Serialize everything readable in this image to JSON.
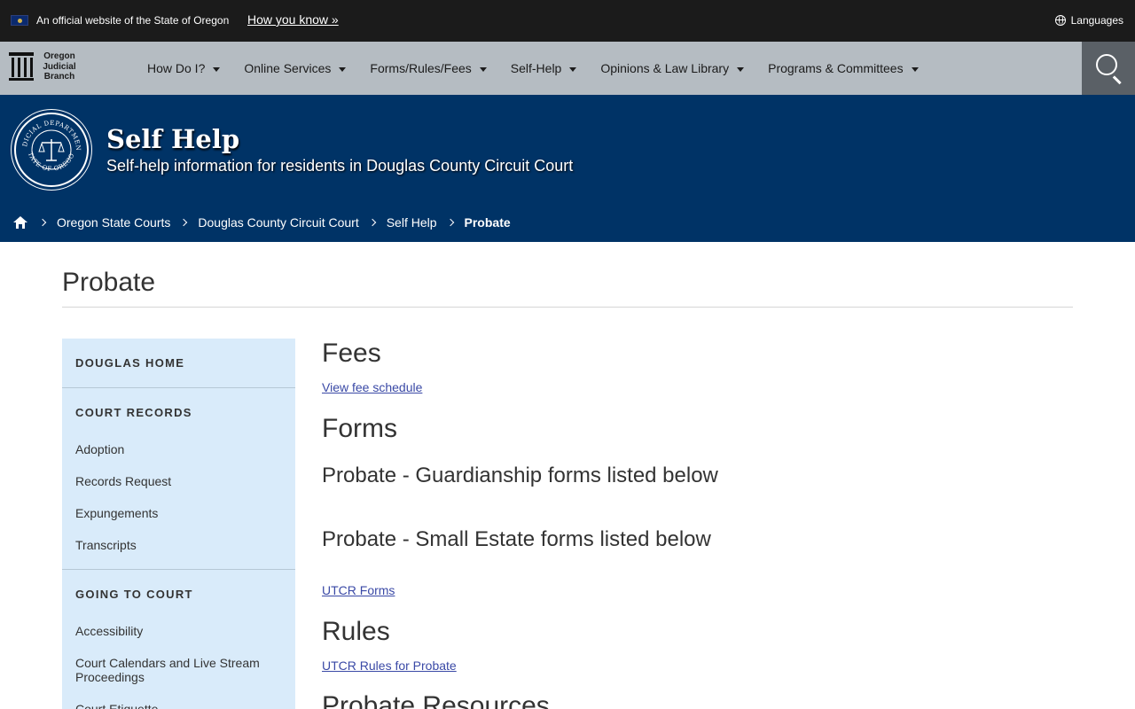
{
  "official_bar": {
    "text": "An official website of the State of Oregon",
    "how_you_know": "How you know »",
    "languages": "Languages"
  },
  "nav": {
    "logo_lines": [
      "Oregon",
      "Judicial",
      "Branch"
    ],
    "items": [
      {
        "label": "How Do I?"
      },
      {
        "label": "Online Services"
      },
      {
        "label": "Forms/Rules/Fees"
      },
      {
        "label": "Self-Help"
      },
      {
        "label": "Opinions & Law Library"
      },
      {
        "label": "Programs & Committees"
      }
    ],
    "search_icon": "search-icon"
  },
  "hero": {
    "title": "Self Help",
    "subtitle": "Self-help information for residents in Douglas County Circuit Court",
    "seal_text_top": "JUDICIAL DEPARTMENT",
    "seal_text_bottom": "STATE OF OREGON"
  },
  "breadcrumb": {
    "items": [
      "Oregon State Courts",
      "Douglas County Circuit Court",
      "Self Help"
    ],
    "current": "Probate"
  },
  "page": {
    "title": "Probate"
  },
  "sidebar": {
    "sections": [
      {
        "heading": "DOUGLAS HOME",
        "items": []
      },
      {
        "heading": "COURT RECORDS",
        "items": [
          "Adoption",
          "Records Request",
          "Expungements",
          "Transcripts"
        ]
      },
      {
        "heading": "GOING TO COURT",
        "items": [
          "Accessibility",
          "Court Calendars and Live Stream Proceedings",
          "Court Etiquette"
        ]
      }
    ]
  },
  "main": {
    "fees_heading": "Fees",
    "fees_link": "View fee schedule",
    "forms_heading": "Forms",
    "guardianship_heading": "Probate - Guardianship forms listed below",
    "small_estate_heading": "Probate - Small Estate forms listed below",
    "utcr_forms_link": "UTCR Forms",
    "rules_heading": "Rules",
    "utcr_rules_link": "UTCR Rules for Probate",
    "resources_heading": "Probate Resources"
  },
  "colors": {
    "hero_bg": "#003366",
    "nav_bg": "#b5bcc2",
    "sidebar_bg": "#d9ebfa",
    "link": "#3a49a6"
  }
}
